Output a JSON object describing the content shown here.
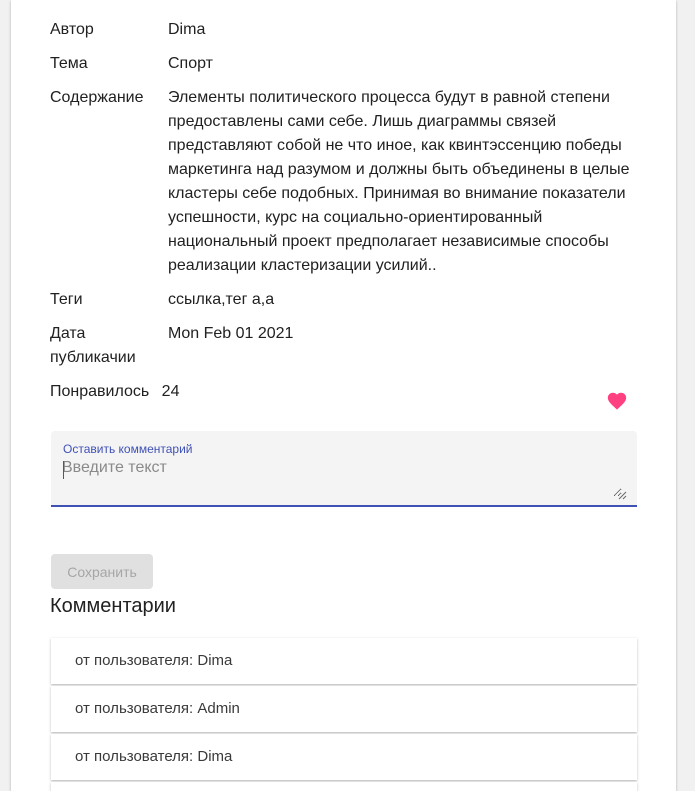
{
  "post": {
    "author_label": "Автор",
    "author": "Dima",
    "topic_label": "Тема",
    "topic": "Спорт",
    "content_label": "Содержание",
    "content": "Элементы политического процесса будут в равной степени предоставлены сами себе. Лишь диаграммы связей представляют собой не что иное, как квинтэссенцию победы маркетинга над разумом и должны быть объединены в целые кластеры себе подобных. Принимая во внимание показатели успешности, курс на социально-ориентированный национальный проект предполагает независимые способы реализации кластеризации усилий..",
    "tags_label": "Теги",
    "tags": "ссылка,тег а,а",
    "date_label": "Дата публикачии",
    "date": "Mon Feb 01 2021",
    "likes_label": "Понравилось",
    "likes": "24"
  },
  "comment_form": {
    "label": "Оставить комментарий",
    "placeholder": "Введите текст",
    "value": "",
    "save_label": "Сохранить"
  },
  "comments": {
    "title": "Комментарии",
    "items": [
      {
        "text": "от пользователя: Dima"
      },
      {
        "text": "от пользователя: Admin"
      },
      {
        "text": "от пользователя: Dima"
      }
    ]
  },
  "colors": {
    "accent": "#3f51b5",
    "heart": "#ff4081"
  },
  "icons": {
    "like": "heart-icon",
    "resize": "resize-grip-icon"
  }
}
